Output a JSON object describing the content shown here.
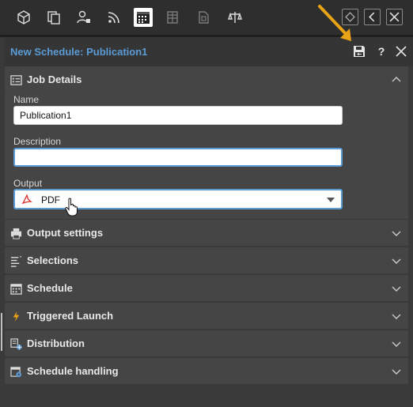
{
  "panel": {
    "title": "New Schedule: Publication1"
  },
  "header_buttons": {
    "help": "?"
  },
  "job_details": {
    "label": "Job Details",
    "name_label": "Name",
    "name_value": "Publication1",
    "description_label": "Description",
    "description_value": "",
    "output_label": "Output",
    "output_value": "PDF"
  },
  "sections": [
    {
      "label": "Output settings",
      "icon": "printer-icon"
    },
    {
      "label": "Selections",
      "icon": "list-filter-icon"
    },
    {
      "label": "Schedule",
      "icon": "calendar-icon"
    },
    {
      "label": "Triggered Launch",
      "icon": "lightning-icon"
    },
    {
      "label": "Distribution",
      "icon": "distribution-icon"
    },
    {
      "label": "Schedule handling",
      "icon": "schedule-gear-icon"
    }
  ],
  "colors": {
    "accent_blue": "#5b9bd5",
    "annotation_arrow": "#e8a317",
    "background": "#3a3a3a",
    "section_bg": "#454545"
  },
  "toolbar_icons": [
    "cube-icon",
    "copy-pages-icon",
    "user-lock-icon",
    "rss-feed-icon",
    "calendar-grid-icon",
    "data-table-icon",
    "document-icon",
    "balance-icon"
  ]
}
